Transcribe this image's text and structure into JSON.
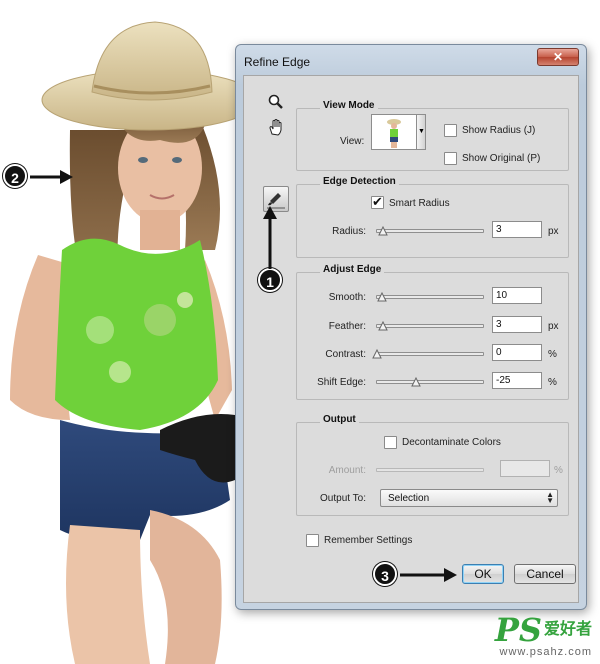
{
  "dialog": {
    "title": "Refine Edge",
    "close_glyph": "✕"
  },
  "tools": {
    "zoom_icon": "magnifier-icon",
    "hand_icon": "hand-icon",
    "refine_radius_icon": "refine-radius-brush-icon"
  },
  "view_mode": {
    "title": "View Mode",
    "view_label": "View:",
    "show_radius": {
      "label": "Show Radius (J)",
      "checked": false
    },
    "show_original": {
      "label": "Show Original (P)",
      "checked": false
    }
  },
  "edge_detection": {
    "title": "Edge Detection",
    "smart_radius": {
      "label": "Smart Radius",
      "checked": true
    },
    "radius": {
      "label": "Radius:",
      "value": "3",
      "unit": "px",
      "level": 0.06
    }
  },
  "adjust_edge": {
    "title": "Adjust Edge",
    "smooth": {
      "label": "Smooth:",
      "value": "10",
      "unit": "",
      "level": 0.05
    },
    "feather": {
      "label": "Feather:",
      "value": "3",
      "unit": "px",
      "level": 0.06
    },
    "contrast": {
      "label": "Contrast:",
      "value": "0",
      "unit": "%",
      "level": 0.0
    },
    "shift": {
      "label": "Shift Edge:",
      "value": "-25",
      "unit": "%",
      "level": 0.37
    }
  },
  "output": {
    "title": "Output",
    "decontaminate": {
      "label": "Decontaminate Colors",
      "checked": false
    },
    "amount": {
      "label": "Amount:",
      "value": "",
      "unit": "%"
    },
    "output_to": {
      "label": "Output To:",
      "selected": "Selection"
    }
  },
  "remember": {
    "label": "Remember Settings",
    "checked": false
  },
  "buttons": {
    "ok": "OK",
    "cancel": "Cancel"
  },
  "callouts": [
    "1",
    "2",
    "3"
  ],
  "watermark": {
    "logo": "PS",
    "cn": "爱好者",
    "url": "www.psahz.com"
  },
  "colors": {
    "shirt": "#6fd13a",
    "callout": "#111111",
    "watermark": "#35a33e"
  }
}
